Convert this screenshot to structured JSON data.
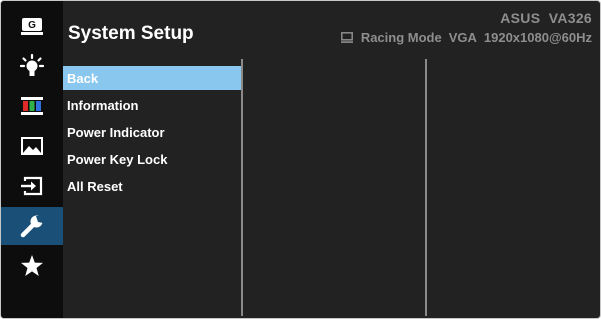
{
  "header": {
    "title": "System Setup",
    "model": "ASUS  VA326",
    "mode": "Racing Mode",
    "input": "VGA",
    "resolution": "1920x1080@60Hz"
  },
  "sidebar": {
    "icons": [
      {
        "name": "gameplus-icon",
        "glyph": "G"
      },
      {
        "name": "splendid-icon"
      },
      {
        "name": "color-icon"
      },
      {
        "name": "image-icon"
      },
      {
        "name": "input-select-icon"
      },
      {
        "name": "system-setup-icon",
        "active": true
      },
      {
        "name": "my-favorite-icon"
      }
    ]
  },
  "menu": {
    "items": [
      {
        "label": "Back",
        "selected": true
      },
      {
        "label": "Information"
      },
      {
        "label": "Power Indicator"
      },
      {
        "label": "Power Key Lock"
      },
      {
        "label": "All Reset"
      }
    ]
  },
  "colors": {
    "accent": "#1a4f77",
    "selection": "#89c7ee",
    "background": "#222223"
  }
}
